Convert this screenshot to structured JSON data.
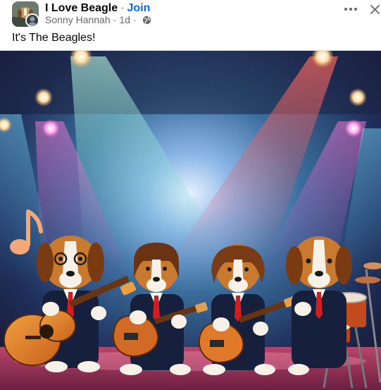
{
  "post": {
    "group_name": "I Love Beagle",
    "separator": "·",
    "join_label": "Join",
    "author": "Sonny Hannah",
    "time": "1d",
    "privacy_icon": "globe-icon",
    "text": "It's The Beagles!"
  },
  "icons": {
    "more": "more-options-icon",
    "close": "close-icon",
    "music_note": "music-note-icon"
  },
  "colors": {
    "link": "#0866ff",
    "secondary_text": "#65676b",
    "primary_text": "#050505"
  }
}
